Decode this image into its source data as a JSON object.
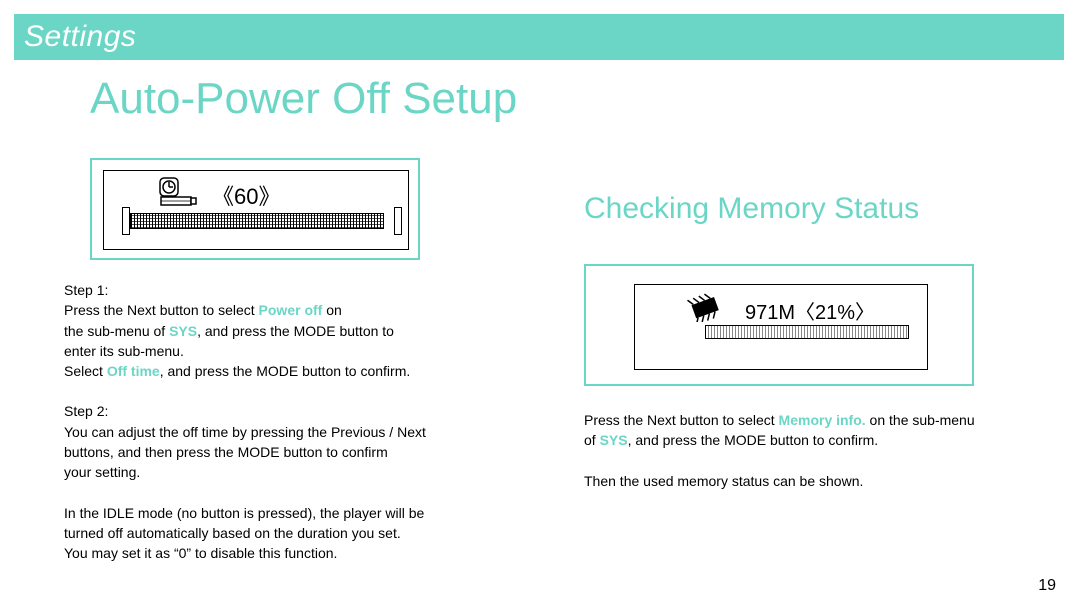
{
  "header": {
    "title": "Settings"
  },
  "titles": {
    "main": "Auto-Power Off Setup",
    "memory": "Checking Memory Status"
  },
  "fig1": {
    "display": "《60》"
  },
  "fig2": {
    "display": "971M〈21%〉"
  },
  "steps": {
    "s1_label": "Step 1:",
    "s1_l1a": "Press the Next button to select ",
    "s1_kw1": "Power off",
    "s1_l1b": " on",
    "s1_l2a": "the sub-menu of ",
    "s1_kw2": "SYS",
    "s1_l2b": ", and press the MODE button to",
    "s1_l3": "enter its sub-menu.",
    "s1_l4a": "Select ",
    "s1_kw3": "Off time",
    "s1_l4b": ", and press the MODE button to confirm.",
    "s2_label": "Step 2:",
    "s2_l1": "You can adjust the off time by pressing the Previous / Next",
    "s2_l2": "buttons, and then press the MODE button to confirm",
    "s2_l3": "your setting.",
    "idle_l1": "In the IDLE mode (no button is pressed), the player will be",
    "idle_l2": "turned off automatically based on the duration you set.",
    "idle_l3": "You may set it as “0” to disable this function."
  },
  "mem": {
    "l1a": "Press the Next button to select ",
    "kw1": "Memory info.",
    "l1b": " on the sub-menu",
    "l2a": "of ",
    "kw2": "SYS",
    "l2b": ", and press the MODE button to confirm.",
    "l3": "Then the used memory status can be shown."
  },
  "page": "19"
}
